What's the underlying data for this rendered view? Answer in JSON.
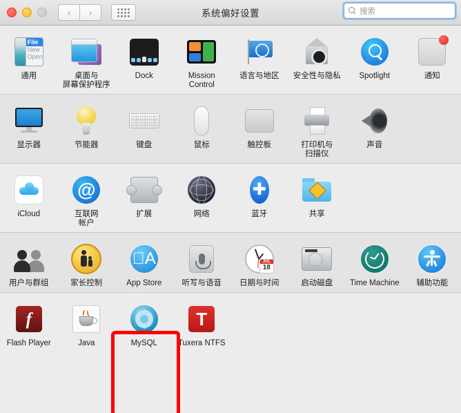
{
  "window": {
    "title": "系统偏好设置",
    "traffic_lights": [
      "close",
      "minimize",
      "zoom"
    ],
    "nav": {
      "back_label": "‹",
      "forward_label": "›",
      "grid_label": "show-all"
    },
    "search": {
      "placeholder": "搜索",
      "value": "",
      "icon": "search-icon"
    }
  },
  "rows": [
    {
      "id": "row-personal",
      "items": [
        {
          "label": "通用",
          "icon": "general-icon"
        },
        {
          "label": "桌面与\n屏幕保护程序",
          "icon": "desktop-screensaver-icon"
        },
        {
          "label": "Dock",
          "icon": "dock-icon"
        },
        {
          "label": "Mission\nControl",
          "icon": "mission-control-icon"
        },
        {
          "label": "语言与地区",
          "icon": "language-region-icon"
        },
        {
          "label": "安全性与隐私",
          "icon": "security-privacy-icon"
        },
        {
          "label": "Spotlight",
          "icon": "spotlight-icon"
        },
        {
          "label": "通知",
          "icon": "notifications-icon",
          "badge": true
        }
      ]
    },
    {
      "id": "row-hardware",
      "items": [
        {
          "label": "显示器",
          "icon": "displays-icon"
        },
        {
          "label": "节能器",
          "icon": "energy-saver-icon"
        },
        {
          "label": "键盘",
          "icon": "keyboard-icon"
        },
        {
          "label": "鼠标",
          "icon": "mouse-icon"
        },
        {
          "label": "触控板",
          "icon": "trackpad-icon"
        },
        {
          "label": "打印机与\n扫描仪",
          "icon": "printers-scanners-icon"
        },
        {
          "label": "声音",
          "icon": "sound-icon"
        }
      ]
    },
    {
      "id": "row-internet",
      "items": [
        {
          "label": "iCloud",
          "icon": "icloud-icon"
        },
        {
          "label": "互联网\n帐户",
          "icon": "internet-accounts-icon"
        },
        {
          "label": "扩展",
          "icon": "extensions-icon"
        },
        {
          "label": "网络",
          "icon": "network-icon"
        },
        {
          "label": "蓝牙",
          "icon": "bluetooth-icon"
        },
        {
          "label": "共享",
          "icon": "sharing-icon"
        }
      ]
    },
    {
      "id": "row-system",
      "items": [
        {
          "label": "用户与群组",
          "icon": "users-groups-icon"
        },
        {
          "label": "家长控制",
          "icon": "parental-controls-icon"
        },
        {
          "label": "App Store",
          "icon": "app-store-icon"
        },
        {
          "label": "听写与语音",
          "icon": "dictation-speech-icon"
        },
        {
          "label": "日期与时间",
          "icon": "date-time-icon",
          "calendar_month": "JUL",
          "calendar_day": "18"
        },
        {
          "label": "启动磁盘",
          "icon": "startup-disk-icon"
        },
        {
          "label": "Time Machine",
          "icon": "time-machine-icon"
        },
        {
          "label": "辅助功能",
          "icon": "accessibility-icon"
        }
      ]
    },
    {
      "id": "row-other",
      "items": [
        {
          "label": "Flash Player",
          "icon": "flash-player-icon",
          "glyph": "f"
        },
        {
          "label": "Java",
          "icon": "java-icon"
        },
        {
          "label": "MySQL",
          "icon": "mysql-icon",
          "highlighted": true
        },
        {
          "label": "Tuxera NTFS",
          "icon": "tuxera-ntfs-icon",
          "glyph": "T"
        }
      ]
    }
  ],
  "highlight": {
    "target": "MySQL",
    "color": "#ff0000"
  },
  "colors": {
    "window_background": "#ececec",
    "row_alt_background": "#e4e4e4",
    "titlebar_top": "#e9e9e9",
    "titlebar_bottom": "#d8d8d8",
    "highlight_red": "#ff0000",
    "search_focus_ring": "#6ea8e2",
    "notification_badge": "#e8241a"
  }
}
